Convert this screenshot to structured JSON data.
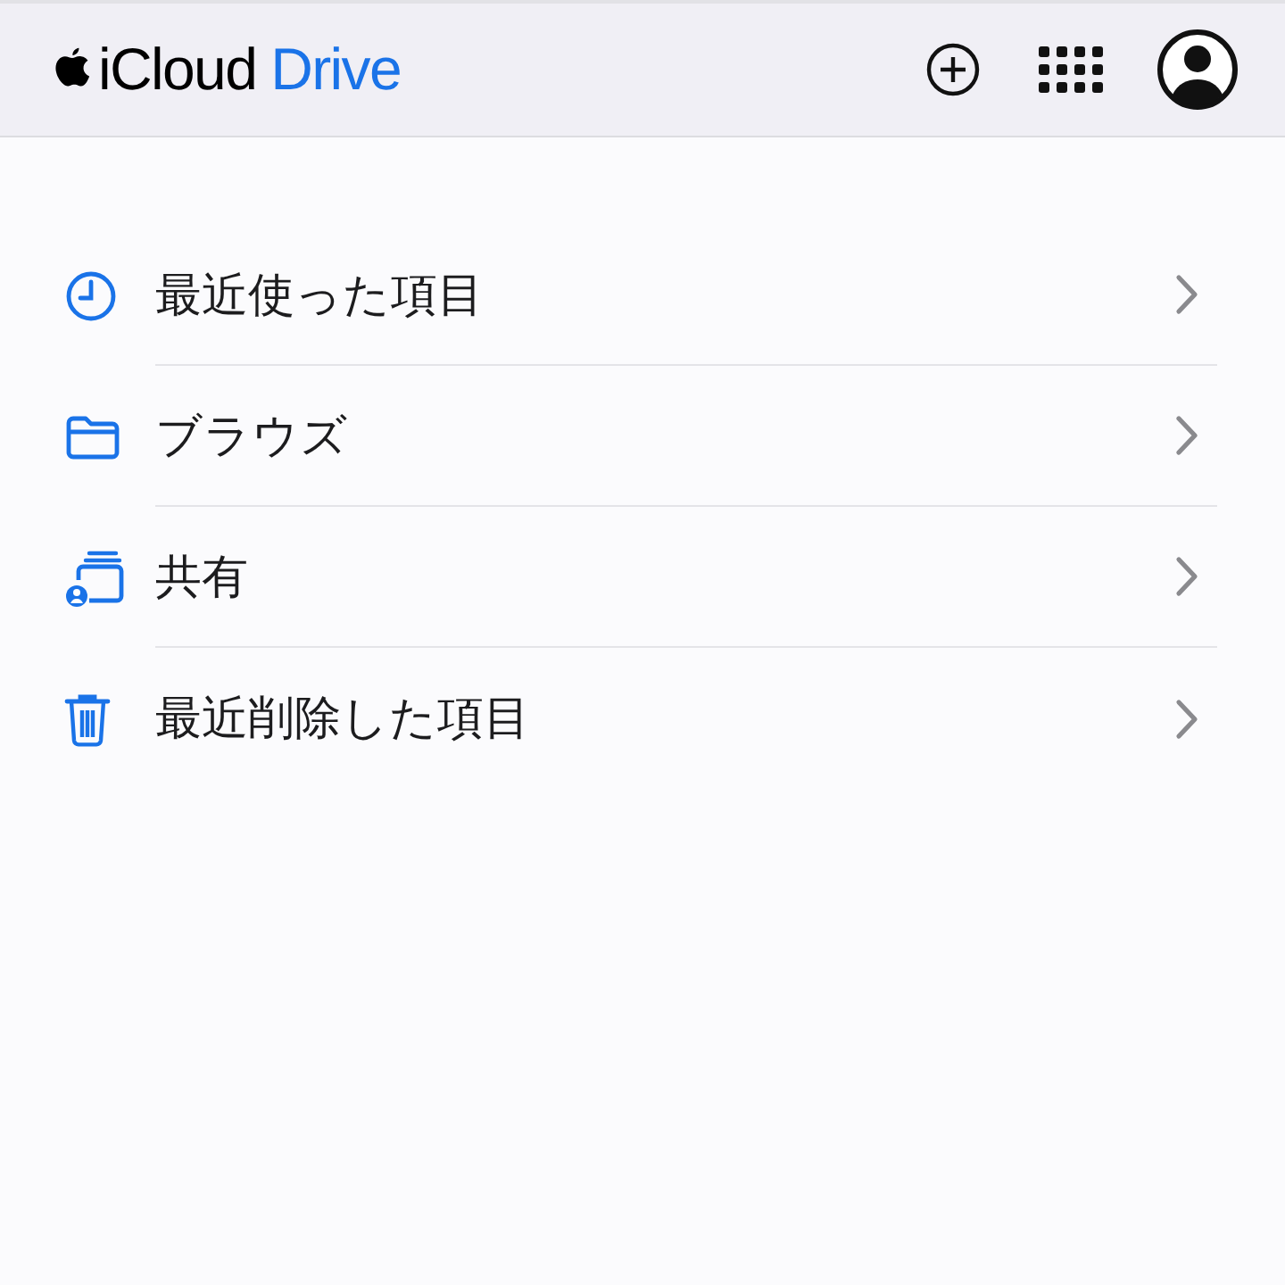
{
  "header": {
    "brand": "iCloud",
    "section": "Drive",
    "actions": [
      {
        "kind": "add"
      },
      {
        "kind": "apps"
      },
      {
        "kind": "account"
      }
    ]
  },
  "items": [
    {
      "kind": "recent",
      "label": "最近使った項目"
    },
    {
      "kind": "browse",
      "label": "ブラウズ"
    },
    {
      "kind": "shared",
      "label": "共有"
    },
    {
      "kind": "deleted",
      "label": "最近削除した項目"
    }
  ]
}
